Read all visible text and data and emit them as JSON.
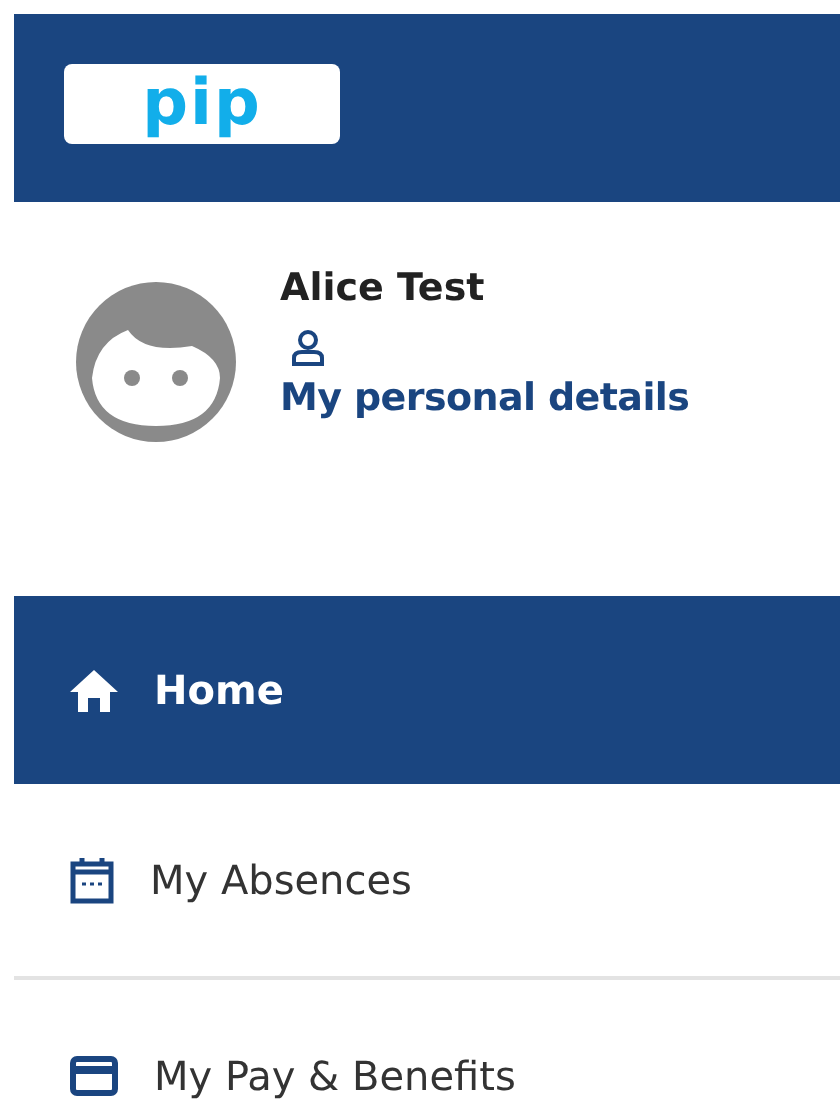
{
  "header": {
    "logo_text": "pip"
  },
  "profile": {
    "name": "Alice Test",
    "link": "My personal details"
  },
  "nav": [
    {
      "label": "Home",
      "selected": true
    },
    {
      "label": "My Absences",
      "selected": false
    },
    {
      "label": "My Pay & Benefits",
      "selected": false
    }
  ]
}
